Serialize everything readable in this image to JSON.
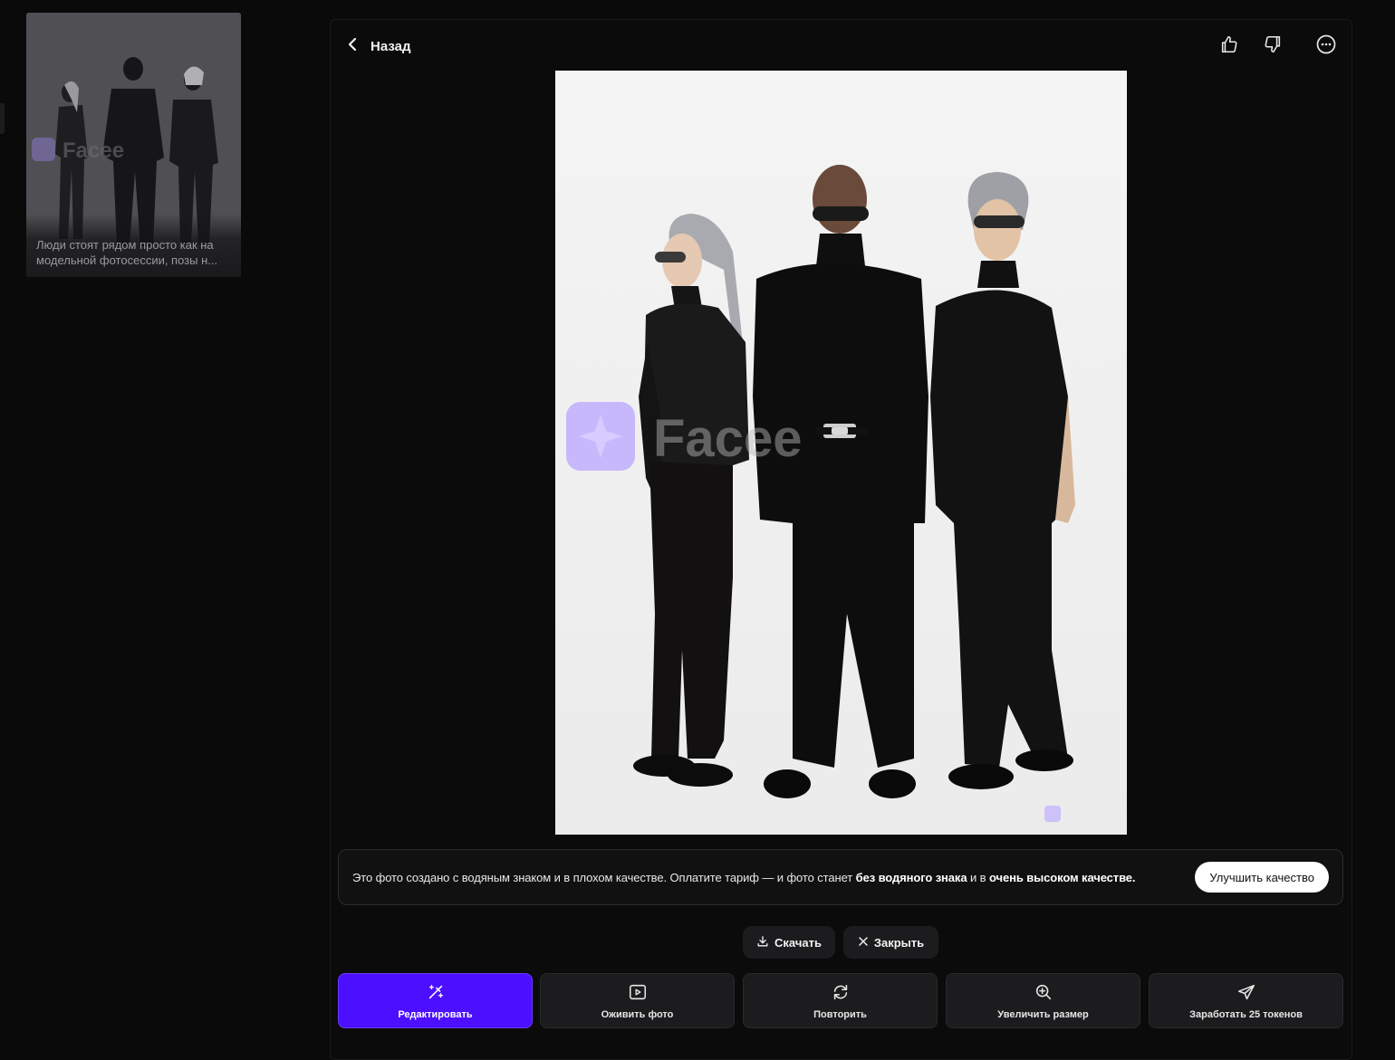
{
  "history": {
    "caption": "Люди стоят рядом просто как на модельной фотосессии, позы н...",
    "watermark_text": "Facee"
  },
  "header": {
    "back_label": "Назад",
    "back_icon": "chevron-left-icon",
    "icons": [
      "thumbs-up-icon",
      "thumbs-down-icon",
      "more-icon"
    ]
  },
  "image": {
    "watermark_text": "Facee"
  },
  "notice": {
    "text_1": "Это фото создано с водяным знаком и в плохом качестве. Оплатите тариф — и фото станет ",
    "bold_1": "без водяного знака",
    "text_2": " и в ",
    "bold_2": "очень высоком качестве.",
    "button_label": "Улучшить качество"
  },
  "actions": {
    "download_label": "Скачать",
    "close_label": "Закрыть"
  },
  "tools": [
    {
      "label": "Редактировать",
      "icon": "magic-wand-icon"
    },
    {
      "label": "Оживить фото",
      "icon": "video-play-icon"
    },
    {
      "label": "Повторить",
      "icon": "repeat-icon"
    },
    {
      "label": "Увеличить размер",
      "icon": "zoom-in-icon"
    },
    {
      "label": "Заработать 25 токенов",
      "icon": "send-icon"
    }
  ],
  "colors": {
    "accent": "#4c0fff",
    "background": "#0a0a0a",
    "watermark": "#b9a6ff"
  }
}
